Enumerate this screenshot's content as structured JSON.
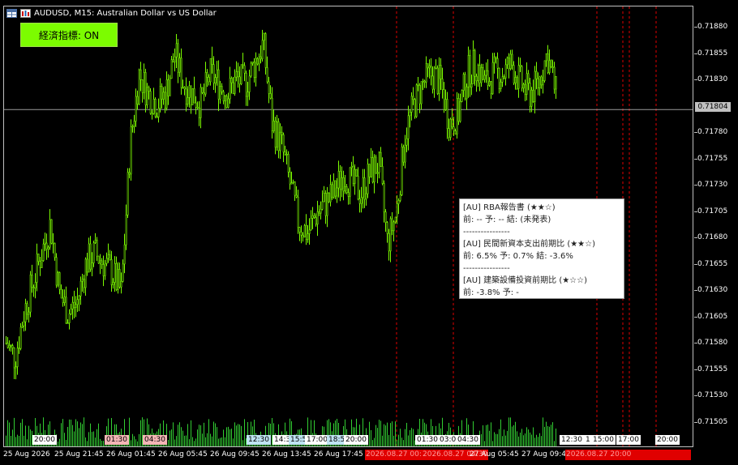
{
  "window": {
    "title": "AUDUSD, M15:  Australian Dollar vs US Dollar"
  },
  "indicator_button": {
    "label": "経済指標: ON"
  },
  "price_axis": {
    "labels": [
      "0.71880",
      "0.71855",
      "0.71830",
      "0.71780",
      "0.71755",
      "0.71730",
      "0.71705",
      "0.71680",
      "0.71655",
      "0.71630",
      "0.71605",
      "0.71580",
      "0.71555",
      "0.71530",
      "0.71505"
    ],
    "current_price": "0.71804"
  },
  "time_axis": {
    "labels": [
      "25 Aug 2026",
      "25 Aug 21:45",
      "26 Aug 01:45",
      "26 Aug 05:45",
      "26 Aug 09:45",
      "26 Aug 13:45",
      "26 Aug 17:45",
      "27 Aug 05:45",
      "27 Aug 09:45"
    ],
    "red_event_labels": [
      "2026.08.27 00:0",
      "2026.08.27 04:30",
      "2026.08.27 20:00"
    ]
  },
  "event_tags": [
    {
      "label": "20:00",
      "color": "#ffffff"
    },
    {
      "label": "01:30",
      "color": "#f4b6b6"
    },
    {
      "label": "04:30",
      "color": "#f4b6b6"
    },
    {
      "label": "12:30",
      "color": "#bfe3f2"
    },
    {
      "label": "14:3",
      "color": "#ffffff"
    },
    {
      "label": "15:5",
      "color": "#bfe3f2"
    },
    {
      "label": "17:00",
      "color": "#ffffff"
    },
    {
      "label": "18:5",
      "color": "#bfe3f2"
    },
    {
      "label": "20:00",
      "color": "#ffffff"
    },
    {
      "label": "01:30",
      "color": "#ffffff"
    },
    {
      "label": "03:00",
      "color": "#ffffff"
    },
    {
      "label": "04:30",
      "color": "#ffffff"
    },
    {
      "label": "12:30",
      "color": "#ffffff"
    },
    {
      "label": "1",
      "color": "#ffffff"
    },
    {
      "label": "15:00",
      "color": "#ffffff"
    },
    {
      "label": "17:00",
      "color": "#ffffff"
    },
    {
      "label": "20:00",
      "color": "#ffffff"
    }
  ],
  "tooltip": {
    "lines": [
      "[AU] RBA報告書 (★★☆)",
      "前: --  予: --  結: (未発表)",
      "----------------",
      "[AU] 民間新資本支出前期比 (★★☆)",
      "前: 6.5%  予: 0.7%  結: -3.6%",
      "----------------",
      "[AU] 建築設備投資前期比 (★☆☆)",
      "前: -3.8%  予: -"
    ]
  },
  "colors": {
    "candle": "#7cfc00",
    "volume": "#32cd32",
    "event_line": "#e00000",
    "grid": "#bfbfbf"
  },
  "chart_data": {
    "type": "candlestick",
    "symbol": "AUDUSD",
    "timeframe": "M15",
    "ylim": [
      0.7148,
      0.71905
    ],
    "close_path": [
      0.7157,
      0.71555,
      0.716,
      0.7163,
      0.7166,
      0.7169,
      0.7162,
      0.716,
      0.7161,
      0.7165,
      0.7166,
      0.7165,
      0.7164,
      0.7162,
      0.7177,
      0.7184,
      0.7182,
      0.7181,
      0.7182,
      0.7186,
      0.7183,
      0.7182,
      0.7181,
      0.7184,
      0.7183,
      0.7182,
      0.71835,
      0.7183,
      0.7185,
      0.7187,
      0.7179,
      0.7177,
      0.7173,
      0.7169,
      0.7168,
      0.717,
      0.7171,
      0.7172,
      0.7174,
      0.7173,
      0.7172,
      0.7174,
      0.7175,
      0.7167,
      0.717,
      0.7178,
      0.7181,
      0.7183,
      0.7184,
      0.7183,
      0.7179,
      0.718,
      0.7184,
      0.7185,
      0.7183,
      0.7184,
      0.7184,
      0.7185,
      0.7183,
      0.7182,
      0.7183,
      0.7186,
      0.7182
    ],
    "grid": false
  }
}
